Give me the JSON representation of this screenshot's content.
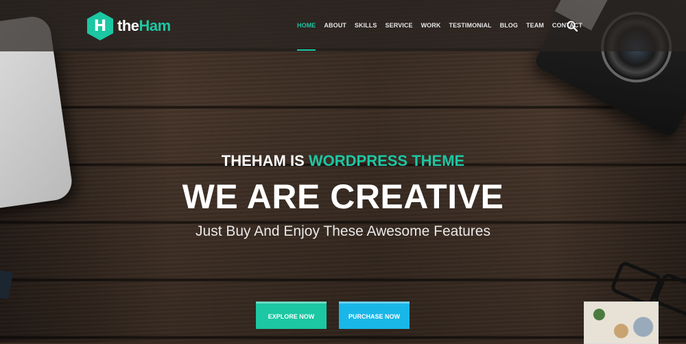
{
  "brand": {
    "logo_letter": "H",
    "name_part1": "the",
    "name_part2": "Ham",
    "accent_color": "#1cc7a3"
  },
  "nav": {
    "items": [
      "HOME",
      "ABOUT",
      "SKILLS",
      "SERVICE",
      "WORK",
      "TESTIMONIAL",
      "BLOG",
      "TEAM",
      "CONTACT"
    ],
    "active": "HOME",
    "search_icon": "search-icon"
  },
  "hero": {
    "eyebrow_prefix": "THEHAM IS ",
    "eyebrow_accent": "WORDPRESS THEME",
    "headline": "WE ARE CREATIVE",
    "subheadline": "Just Buy And Enjoy These Awesome Features",
    "buttons": {
      "explore": "EXPLORE NOW",
      "purchase": "PURCHASE NOW"
    },
    "colors": {
      "explore": "#1cc7a3",
      "purchase": "#19b7e8"
    }
  }
}
